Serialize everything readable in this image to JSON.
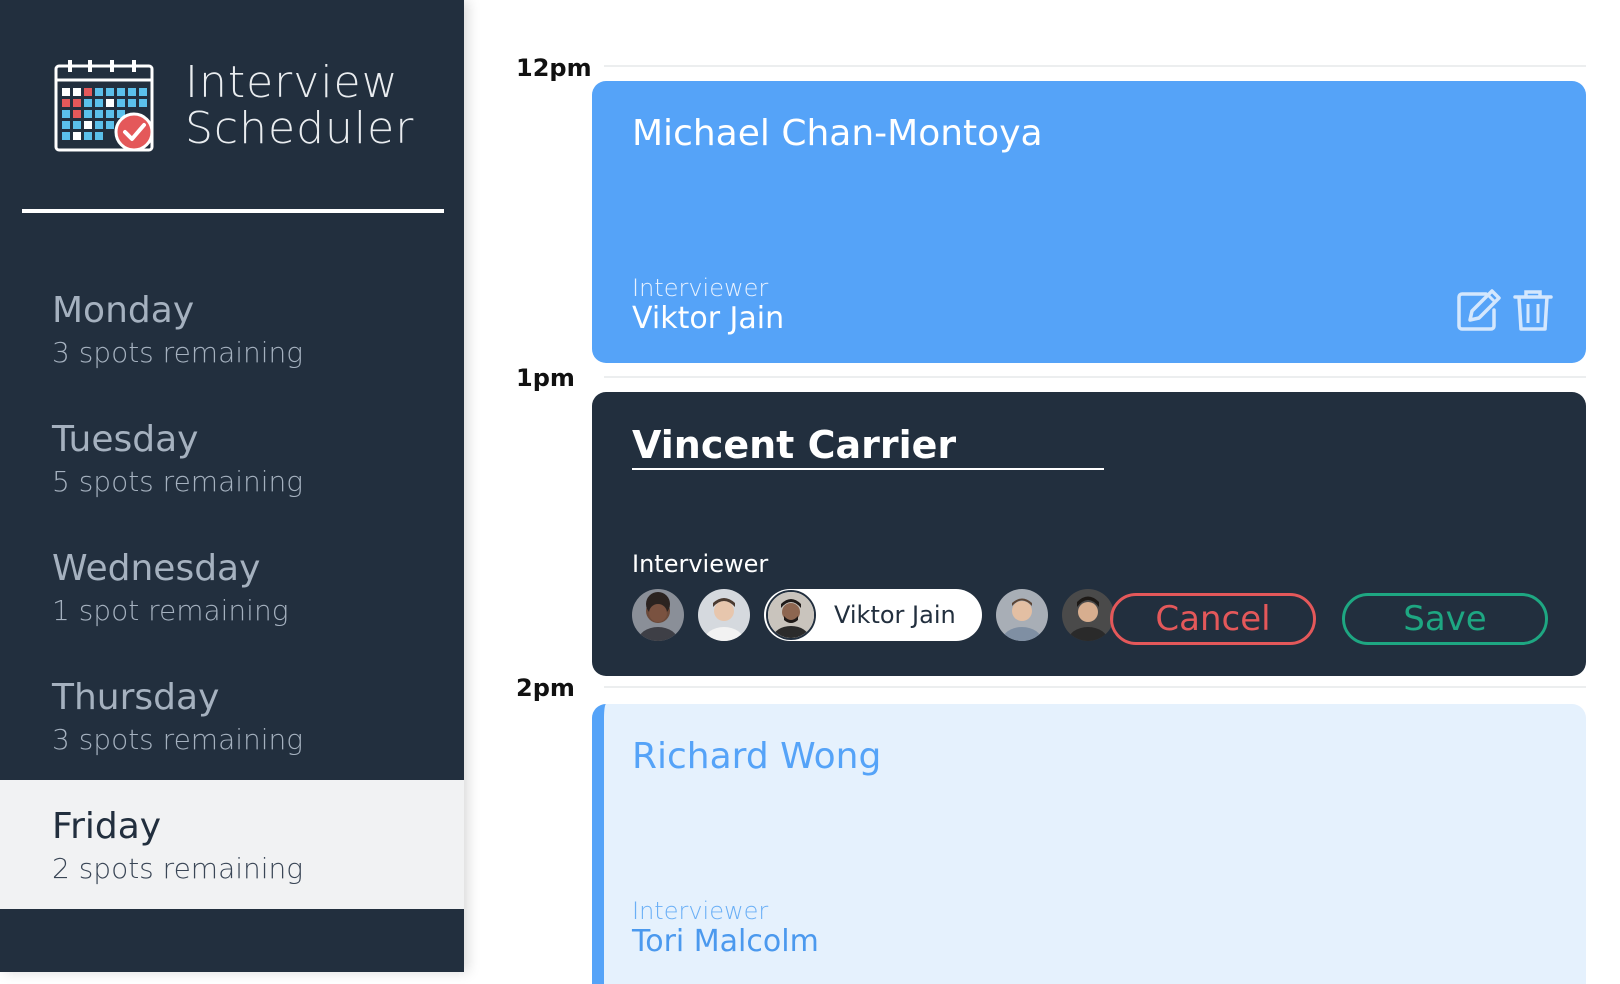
{
  "app": {
    "title_line1": "Interview",
    "title_line2": "Scheduler"
  },
  "sidebar": {
    "days": [
      {
        "name": "Monday",
        "spots": "3 spots remaining",
        "selected": false
      },
      {
        "name": "Tuesday",
        "spots": "5 spots remaining",
        "selected": false
      },
      {
        "name": "Wednesday",
        "spots": "1 spot remaining",
        "selected": false
      },
      {
        "name": "Thursday",
        "spots": "3 spots remaining",
        "selected": false
      },
      {
        "name": "Friday",
        "spots": "2 spots remaining",
        "selected": true
      }
    ]
  },
  "schedule": {
    "times": [
      "12pm",
      "1pm",
      "2pm"
    ],
    "appointments": [
      {
        "student": "Michael Chan-Montoya",
        "interviewer_label": "Interviewer",
        "interviewer": "Viktor Jain"
      },
      {
        "student_input_value": "Vincent Carrier",
        "interviewer_label": "Interviewer",
        "selected_interviewer": "Viktor Jain",
        "cancel_label": "Cancel",
        "save_label": "Save"
      },
      {
        "student": "Richard Wong",
        "interviewer_label": "Interviewer",
        "interviewer": "Tori Malcolm"
      }
    ]
  },
  "icons": {
    "edit": "edit-icon",
    "delete": "trash-icon",
    "logo": "calendar-check-icon"
  },
  "colors": {
    "sidebar_bg": "#222f3e",
    "booked_card": "#55a3f8",
    "edit_card": "#222f3e",
    "empty_card": "#e5f1fd",
    "cancel": "#e4585a",
    "save": "#1ea782"
  }
}
